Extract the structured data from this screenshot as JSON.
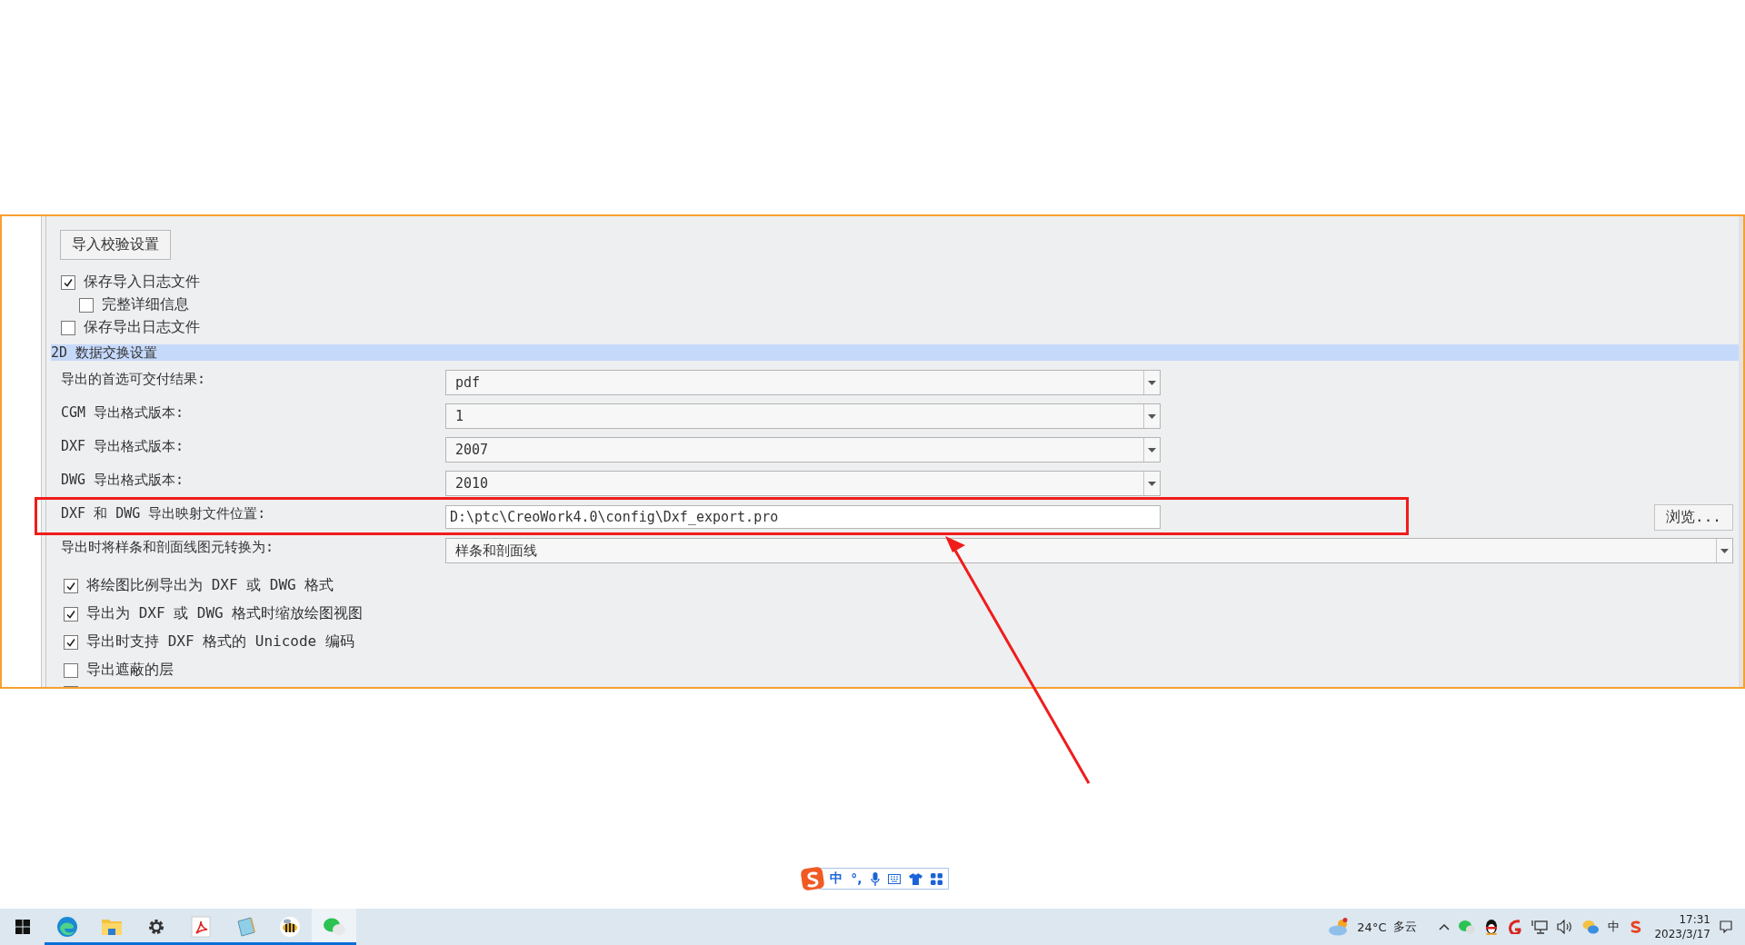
{
  "panel": {
    "import_button": "导入校验设置",
    "log_options": [
      {
        "label": "保存导入日志文件",
        "checked": true,
        "children": [
          {
            "label": "完整详细信息",
            "checked": false
          }
        ]
      },
      {
        "label": "保存导出日志文件",
        "checked": false
      }
    ],
    "section": {
      "title": "2D 数据交换设置",
      "rows": [
        {
          "kind": "select",
          "label": "导出的首选可交付结果:",
          "value": "pdf"
        },
        {
          "kind": "select",
          "label": "CGM 导出格式版本:",
          "value": "1"
        },
        {
          "kind": "select",
          "label": "DXF 导出格式版本:",
          "value": "2007"
        },
        {
          "kind": "select",
          "label": "DWG 导出格式版本:",
          "value": "2010"
        },
        {
          "kind": "path",
          "label": "DXF 和 DWG 导出映射文件位置:",
          "value": "D:\\ptc\\CreoWork4.0\\config\\Dxf_export.pro",
          "button": "浏览..."
        },
        {
          "kind": "fullselect",
          "label": "导出时将样条和剖面线图元转换为:",
          "value": "样条和剖面线"
        }
      ],
      "checks": [
        {
          "label": "将绘图比例导出为 DXF 或 DWG 格式",
          "checked": true
        },
        {
          "label": "导出为 DXF 或 DWG 格式时缩放绘图视图",
          "checked": true
        },
        {
          "label": "导出时支持 DXF 格式的 Unicode 编码",
          "checked": true
        },
        {
          "label": "导出遮蔽的层",
          "checked": false
        }
      ]
    }
  },
  "ime_bar": {
    "mode": "中",
    "punctuation": "°,"
  },
  "taskbar": {
    "apps": [
      {
        "kind": "edge",
        "running": true,
        "selected": false
      },
      {
        "kind": "folder",
        "running": true,
        "selected": false
      },
      {
        "kind": "gear",
        "running": true,
        "selected": false
      },
      {
        "kind": "pdf",
        "running": true,
        "selected": false
      },
      {
        "kind": "notepad",
        "running": true,
        "selected": false
      },
      {
        "kind": "bee",
        "running": true,
        "selected": false
      },
      {
        "kind": "chat",
        "running": true,
        "selected": true
      }
    ],
    "weather": {
      "temperature": "24°C",
      "condition": "多云"
    },
    "input_mode": "中",
    "time": "17:31",
    "date": "2023/3/17"
  }
}
